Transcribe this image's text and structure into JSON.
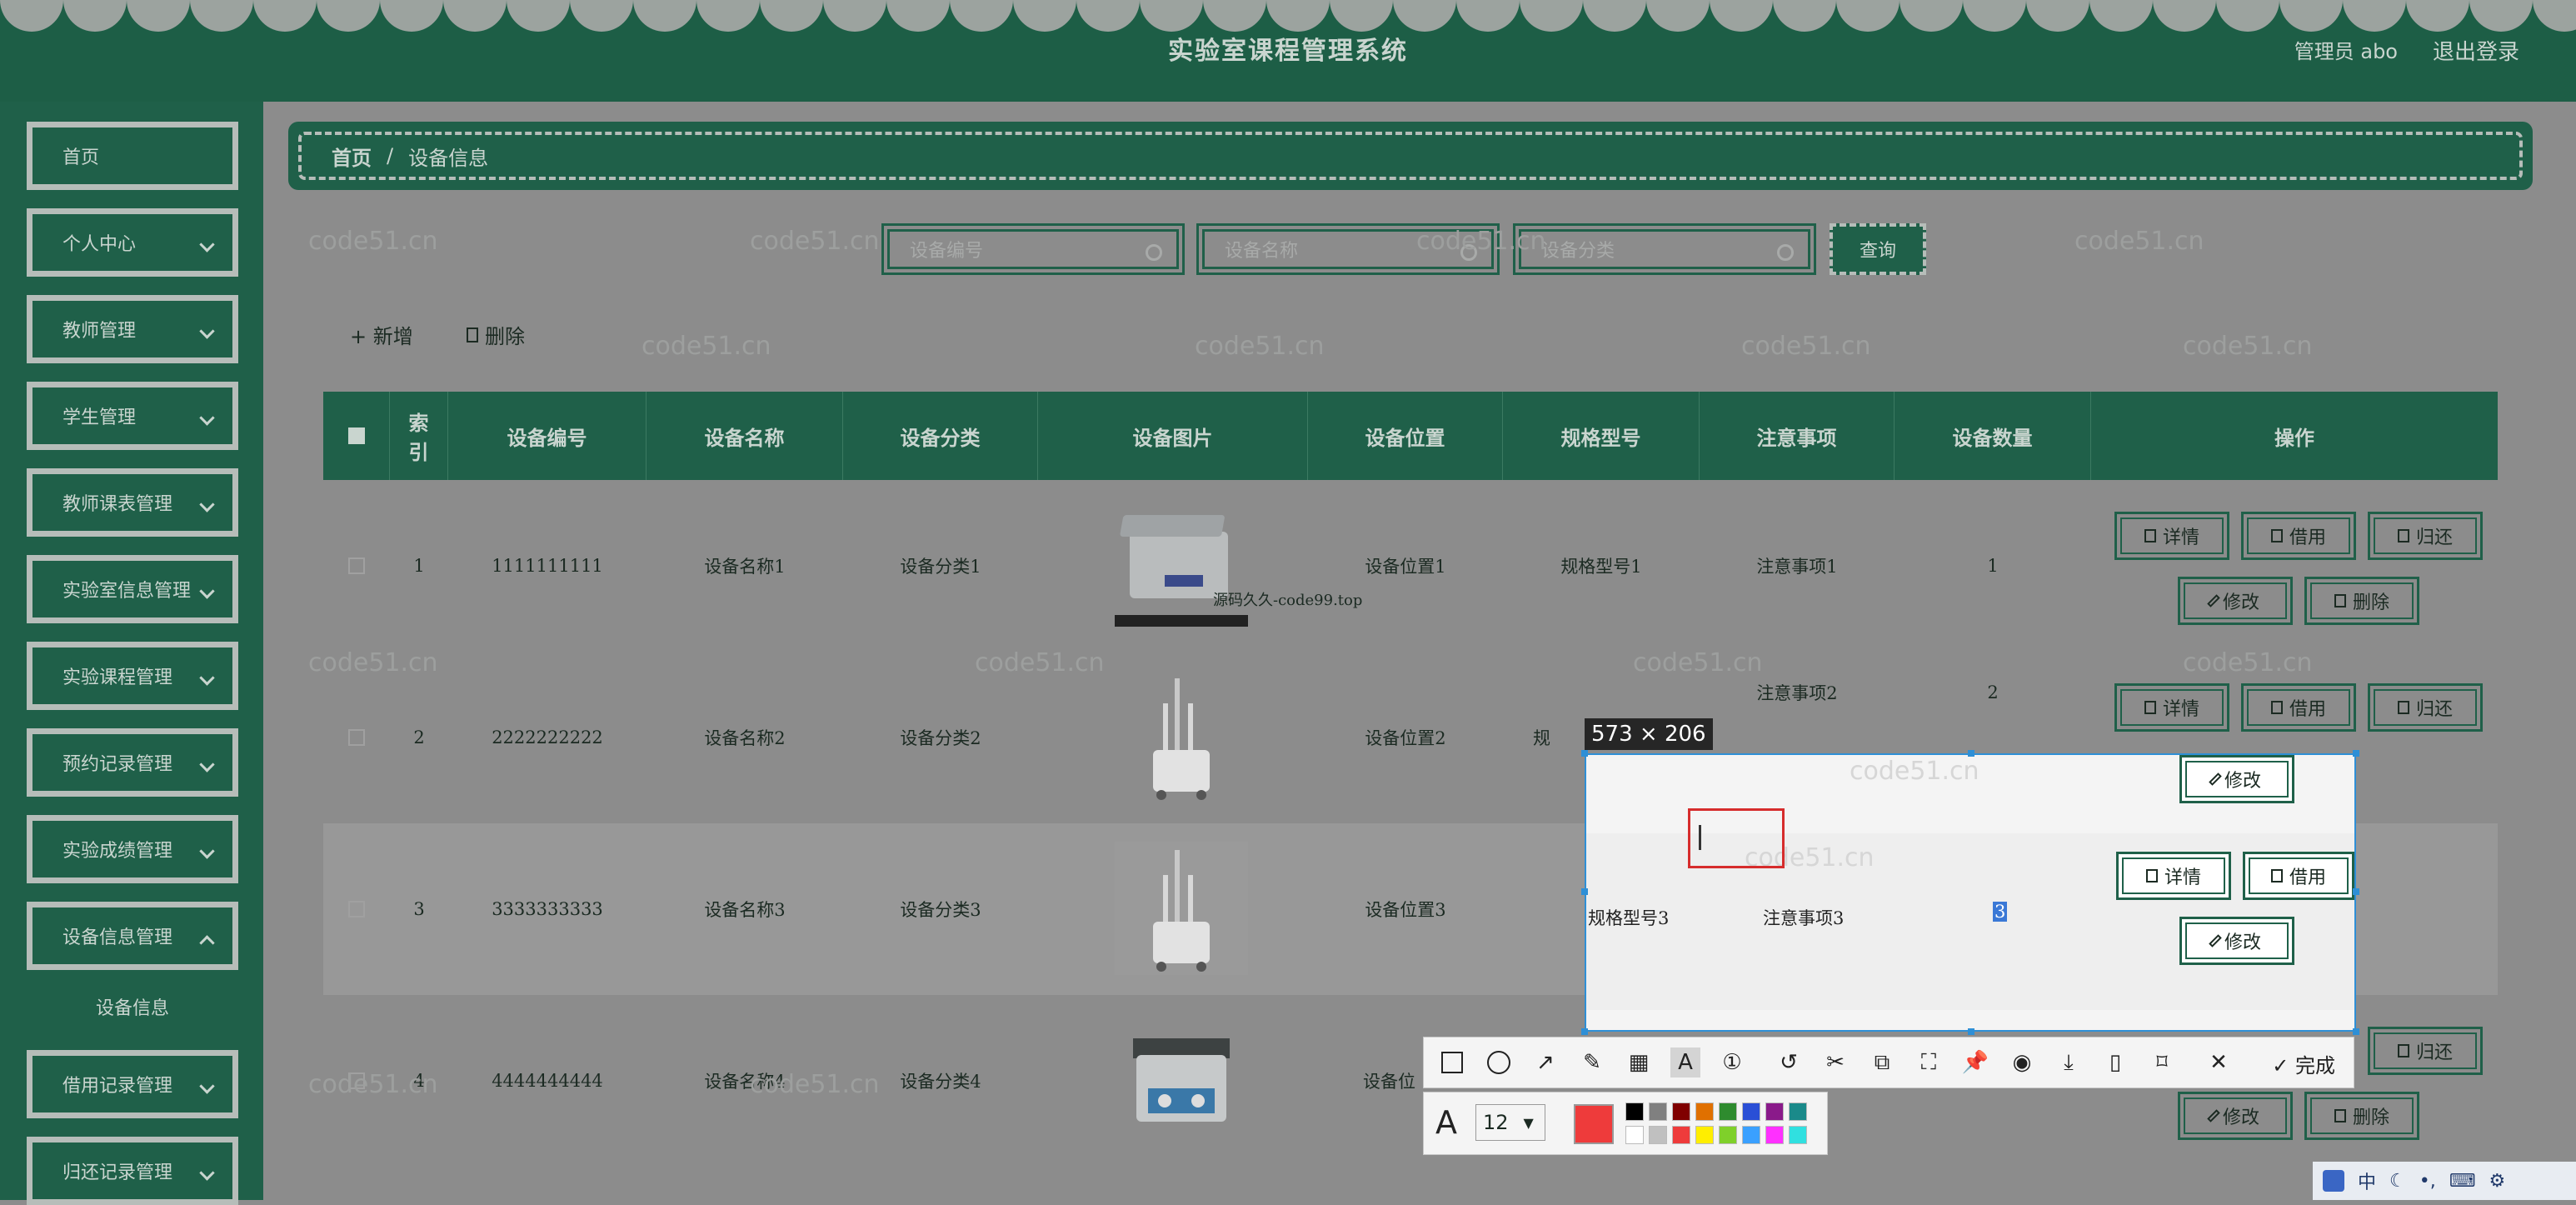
{
  "header": {
    "title": "实验室课程管理系统",
    "user_label": "管理员 abo",
    "logout_label": "退出登录"
  },
  "sidebar": {
    "items": [
      {
        "label": "首页"
      },
      {
        "label": "个人中心"
      },
      {
        "label": "教师管理"
      },
      {
        "label": "学生管理"
      },
      {
        "label": "教师课表管理"
      },
      {
        "label": "实验室信息管理"
      },
      {
        "label": "实验课程管理"
      },
      {
        "label": "预约记录管理"
      },
      {
        "label": "实验成绩管理"
      },
      {
        "label": "设备信息管理"
      },
      {
        "label": "借用记录管理"
      },
      {
        "label": "归还记录管理"
      }
    ],
    "sub_item": "设备信息"
  },
  "breadcrumb": {
    "home": "首页",
    "separator": "/",
    "current": "设备信息"
  },
  "search": {
    "fields": [
      {
        "placeholder": "设备编号"
      },
      {
        "placeholder": "设备名称"
      },
      {
        "placeholder": "设备分类"
      }
    ],
    "query_label": "查询"
  },
  "actions": {
    "add_label": "+ 新增",
    "delete_label": "删除"
  },
  "table": {
    "columns": [
      "索引",
      "设备编号",
      "设备名称",
      "设备分类",
      "设备图片",
      "设备位置",
      "规格型号",
      "注意事项",
      "设备数量",
      "操作"
    ],
    "rows": [
      {
        "index": "1",
        "code": "1111111111",
        "name": "设备名称1",
        "category": "设备分类1",
        "location": "设备位置1",
        "spec": "规格型号1",
        "note": "注意事项1",
        "qty": "1"
      },
      {
        "index": "2",
        "code": "2222222222",
        "name": "设备名称2",
        "category": "设备分类2",
        "location": "设备位置2",
        "spec": "规",
        "note": "注意事项2",
        "qty": "2"
      },
      {
        "index": "3",
        "code": "3333333333",
        "name": "设备名称3",
        "category": "设备分类3",
        "location": "设备位置3",
        "spec": "规格型号3",
        "note": "注意事项3",
        "qty": "3"
      },
      {
        "index": "4",
        "code": "4444444444",
        "name": "设备名称4",
        "category": "设备分类4",
        "location": "设备位",
        "spec": "",
        "note": "",
        "qty": ""
      }
    ],
    "op_labels": {
      "detail": "详情",
      "borrow": "借用",
      "return": "归还",
      "edit": "修改",
      "delete": "删除"
    },
    "image_caption": "源码久久-code99.top"
  },
  "watermark": "code51.cn",
  "screenshot_tool": {
    "size_label": "573 × 206",
    "done_label": "完成",
    "font_size": "12",
    "active_color": "#ee3b3b",
    "palette": [
      "#000000",
      "#808080",
      "#800000",
      "#e07000",
      "#2e8b2e",
      "#2a4fd6",
      "#8a1a8a",
      "#1a8a8a",
      "#ffffff",
      "#c0c0c0",
      "#ee3b3b",
      "#ffee00",
      "#7fd02a",
      "#3aa0ff",
      "#ff30ff",
      "#30e0e0"
    ]
  },
  "tray": {
    "ime": "中"
  }
}
